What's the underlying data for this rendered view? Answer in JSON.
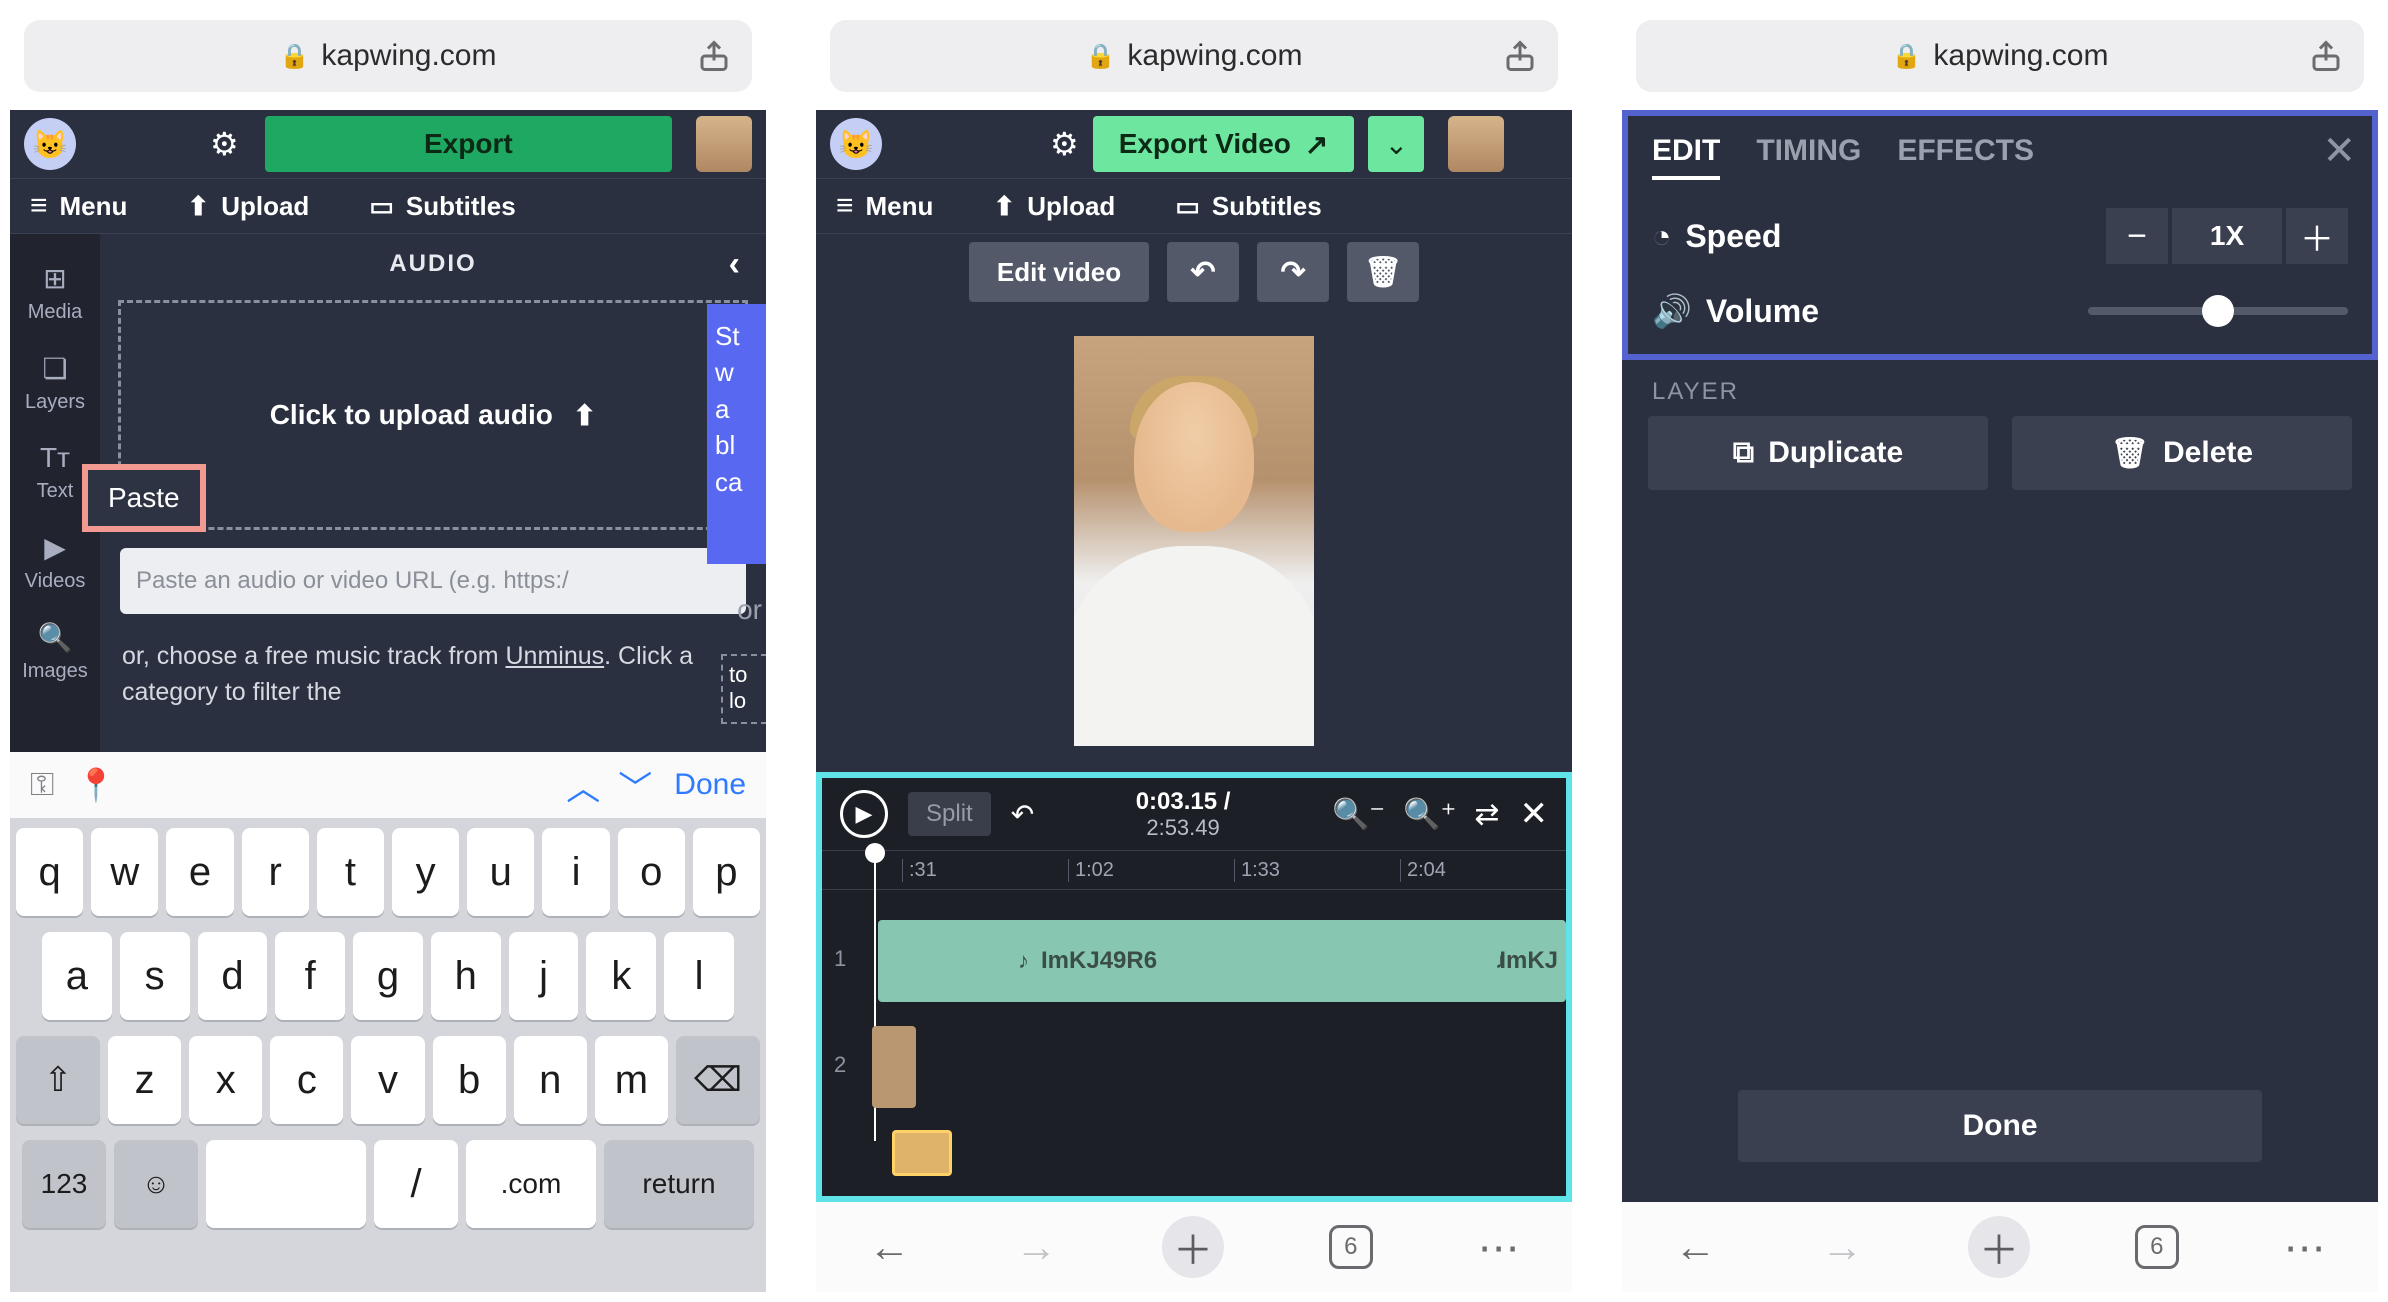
{
  "browser": {
    "url": "kapwing.com"
  },
  "screen1": {
    "export": "Export",
    "menu": "Menu",
    "upload": "Upload",
    "subtitles": "Subtitles",
    "side": {
      "media": "Media",
      "layers": "Layers",
      "text": "Text",
      "videos": "Videos",
      "images": "Images"
    },
    "audio_header": "AUDIO",
    "upload_audio": "Click to upload audio",
    "paste": "Paste",
    "url_placeholder": "Paste an audio or video URL (e.g. https:/",
    "help_pre": "or, choose a free music track from ",
    "unminus": "Unminus",
    "help_post": ". Click a category to filter the",
    "blue_text": "St\nw\na\nbl\nca",
    "or": "or",
    "dash_text": "to\nlo",
    "kb": {
      "done": "Done",
      "r1": [
        "q",
        "w",
        "e",
        "r",
        "t",
        "y",
        "u",
        "i",
        "o",
        "p"
      ],
      "r2": [
        "a",
        "s",
        "d",
        "f",
        "g",
        "h",
        "j",
        "k",
        "l"
      ],
      "r3": [
        "z",
        "x",
        "c",
        "v",
        "b",
        "n",
        "m"
      ],
      "num": "123",
      "slash": "/",
      "com": ".com",
      "return": "return"
    }
  },
  "screen2": {
    "export": "Export Video",
    "menu": "Menu",
    "upload": "Upload",
    "subtitles": "Subtitles",
    "edit_video": "Edit video",
    "time_current": "0:03.15 /",
    "time_total": "2:53.49",
    "split": "Split",
    "ruler": [
      ":31",
      "1:02",
      "1:33",
      "2:04"
    ],
    "clip1": "ImKJ49R6",
    "clip1b": "ImKJ",
    "track1": "1",
    "track2": "2",
    "tabs_count": "6"
  },
  "screen3": {
    "tabs": {
      "edit": "EDIT",
      "timing": "TIMING",
      "effects": "EFFECTS"
    },
    "speed": "Speed",
    "speed_val": "1X",
    "volume": "Volume",
    "layer": "LAYER",
    "duplicate": "Duplicate",
    "delete": "Delete",
    "done": "Done",
    "tabs_count": "6"
  }
}
